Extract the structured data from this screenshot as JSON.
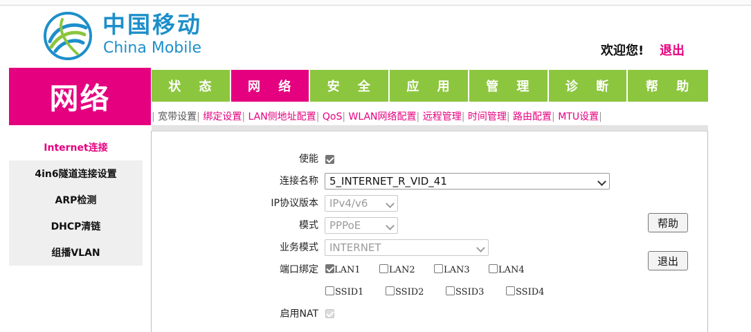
{
  "brand": {
    "cn": "中国移动",
    "en": "China Mobile",
    "logo_icon": "china-mobile-logo-icon",
    "color": "#1d8fca"
  },
  "header": {
    "welcome": "欢迎您!",
    "logout": "退出"
  },
  "section_title": "网络",
  "nav": {
    "tabs": [
      {
        "label": "状 态"
      },
      {
        "label": "网 络",
        "active": true
      },
      {
        "label": "安 全"
      },
      {
        "label": "应 用"
      },
      {
        "label": "管 理"
      },
      {
        "label": "诊 断"
      },
      {
        "label": "帮 助"
      }
    ],
    "active_color": "#e5007f",
    "tab_color": "#8cc63f"
  },
  "subnav": [
    {
      "label": "宽带设置",
      "current": true
    },
    {
      "label": "绑定设置"
    },
    {
      "label": "LAN侧地址配置"
    },
    {
      "label": "QoS"
    },
    {
      "label": "WLAN网络配置"
    },
    {
      "label": "远程管理"
    },
    {
      "label": "时间管理"
    },
    {
      "label": "路由配置"
    },
    {
      "label": "MTU设置"
    }
  ],
  "sidebar": {
    "items": [
      {
        "label": "Internet连接",
        "active": true
      },
      {
        "label": "4in6隧道连接设置"
      },
      {
        "label": "ARP检测"
      },
      {
        "label": "DHCP清链"
      },
      {
        "label": "组播VLAN"
      }
    ]
  },
  "form": {
    "enable": {
      "label": "使能",
      "checked": true
    },
    "connection_name": {
      "label": "连接名称",
      "value": "5_INTERNET_R_VID_41"
    },
    "ip_version": {
      "label": "IP协议版本",
      "value": "IPv4/v6"
    },
    "mode": {
      "label": "模式",
      "value": "PPPoE"
    },
    "service_mode": {
      "label": "业务模式",
      "value": "INTERNET"
    },
    "port_binding": {
      "label": "端口绑定",
      "lan": [
        {
          "label": "LAN1",
          "checked": true
        },
        {
          "label": "LAN2",
          "checked": false
        },
        {
          "label": "LAN3",
          "checked": false
        },
        {
          "label": "LAN4",
          "checked": false
        }
      ],
      "ssid": [
        {
          "label": "SSID1",
          "checked": false
        },
        {
          "label": "SSID2",
          "checked": false
        },
        {
          "label": "SSID3",
          "checked": false
        },
        {
          "label": "SSID4",
          "checked": false
        }
      ]
    },
    "nat": {
      "label": "启用NAT",
      "checked": true
    }
  },
  "buttons": {
    "help": "帮助",
    "exit": "退出"
  }
}
